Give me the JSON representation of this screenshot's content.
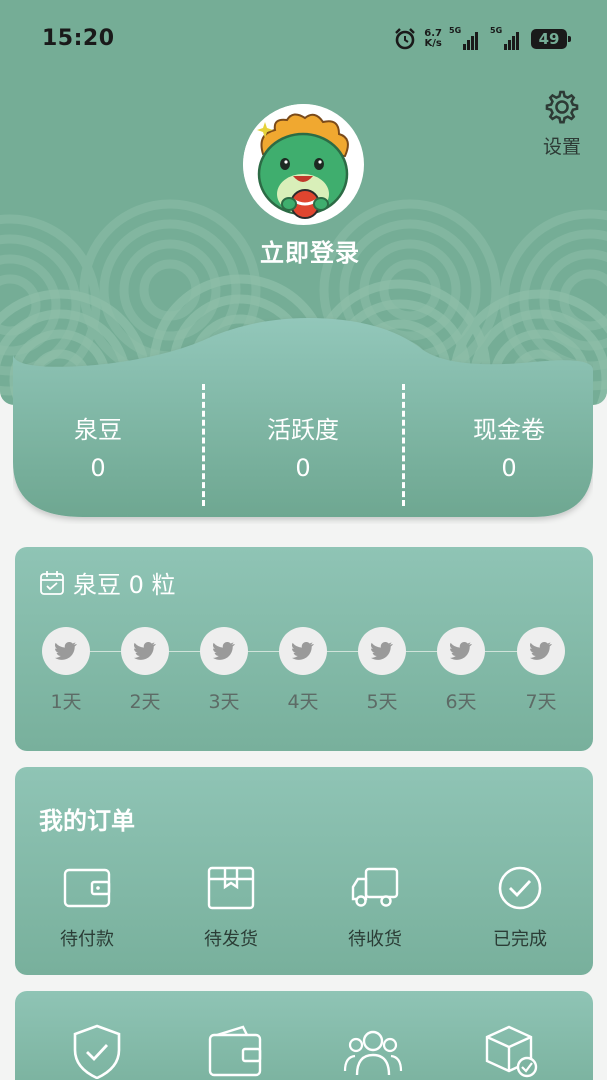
{
  "status_bar": {
    "time": "15:20",
    "net_speed_value": "6.7",
    "net_speed_unit": "K/s",
    "signal_1_label": "5G",
    "signal_2_label": "5G",
    "battery": "49"
  },
  "header": {
    "settings_label": "设置",
    "login_label": "立即登录"
  },
  "stats": [
    {
      "label": "泉豆",
      "value": "0"
    },
    {
      "label": "活跃度",
      "value": "0"
    },
    {
      "label": "现金卷",
      "value": "0"
    }
  ],
  "checkin": {
    "title": "泉豆 0 粒",
    "days": [
      "1天",
      "2天",
      "3天",
      "4天",
      "5天",
      "6天",
      "7天"
    ]
  },
  "orders": {
    "title": "我的订单",
    "items": [
      {
        "label": "待付款",
        "icon": "wallet-icon"
      },
      {
        "label": "待发货",
        "icon": "box-icon"
      },
      {
        "label": "待收货",
        "icon": "truck-icon"
      },
      {
        "label": "已完成",
        "icon": "check-circle-icon"
      }
    ]
  },
  "services": {
    "icons": [
      "shield-check-icon",
      "wallet-icon",
      "users-icon",
      "package-check-icon"
    ]
  },
  "colors": {
    "primary": "#75ad96",
    "panel_top": "#8fc4b5",
    "panel_bottom": "#78b09c"
  }
}
